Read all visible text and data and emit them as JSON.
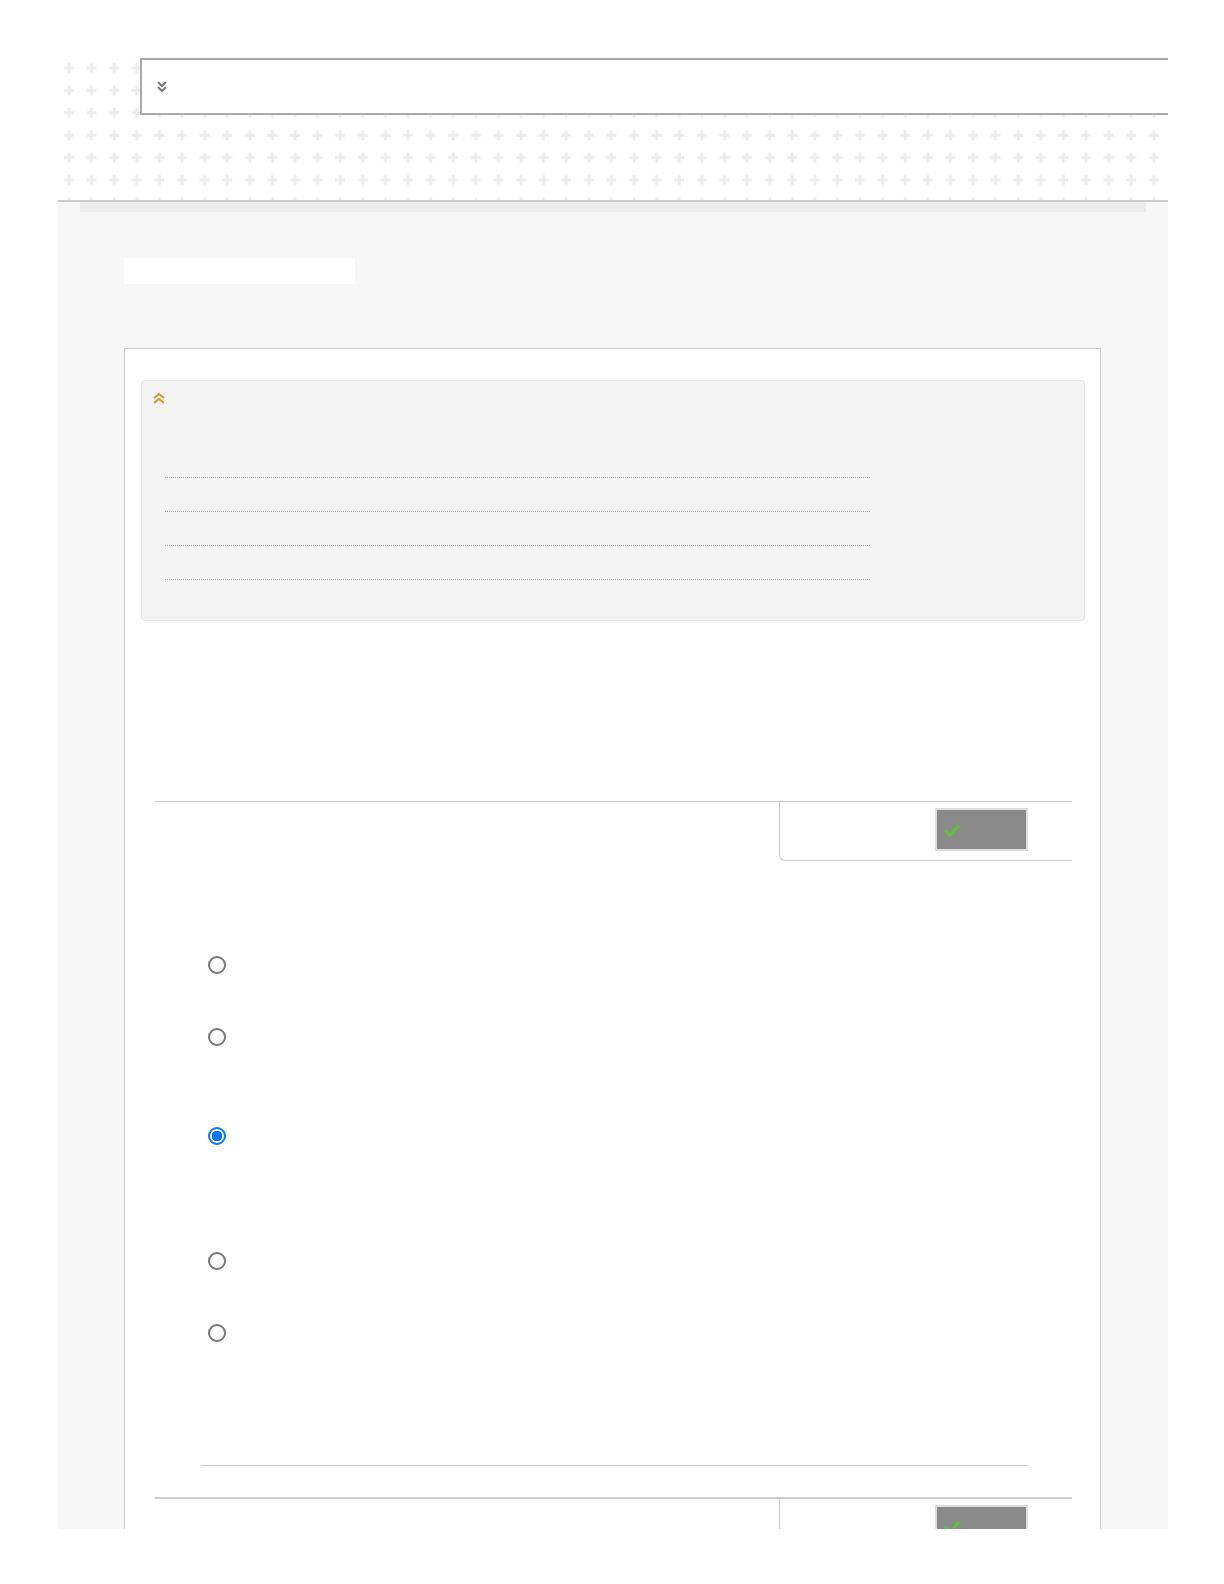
{
  "question": {
    "options": [
      {
        "selected": false
      },
      {
        "selected": false
      },
      {
        "selected": true
      },
      {
        "selected": false
      },
      {
        "selected": false
      }
    ]
  }
}
